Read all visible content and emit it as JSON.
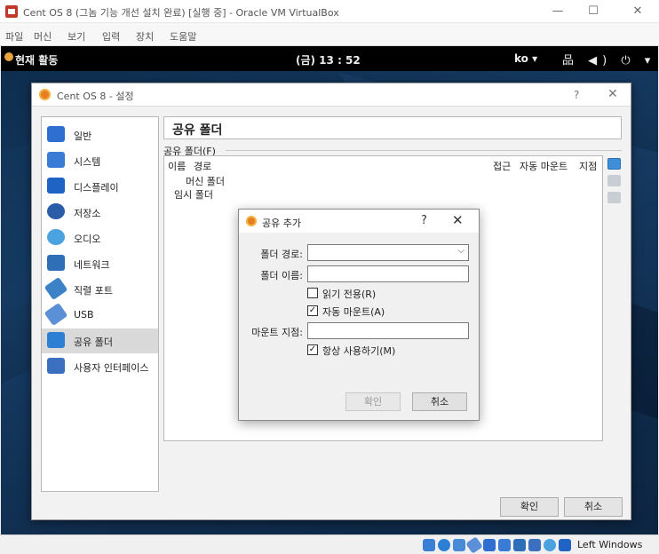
{
  "vbox": {
    "title": "Cent OS 8 (그놈 기능 개선 설치 완료) [실행 중] - Oracle VM VirtualBox",
    "menu": [
      "파일",
      "머신",
      "보기",
      "입력",
      "장치",
      "도움말"
    ],
    "controls": {
      "minimize": "—",
      "maximize": "☐",
      "close": "✕"
    }
  },
  "gnome": {
    "activities": "현재 활동",
    "clock": "(금) 13 : 52",
    "lang": "ko ▾",
    "sys": "品 ◀) ⏻ ▾"
  },
  "settings": {
    "title": "Cent OS 8 - 설정",
    "help": "?",
    "close": "✕",
    "nav": [
      {
        "label": "일반",
        "icon": "general-icon",
        "color": "#2e6fd1"
      },
      {
        "label": "시스템",
        "icon": "system-icon",
        "color": "#3a7bd5"
      },
      {
        "label": "디스플레이",
        "icon": "display-icon",
        "color": "#1f63c4"
      },
      {
        "label": "저장소",
        "icon": "storage-icon",
        "color": "#2a5ca8"
      },
      {
        "label": "오디오",
        "icon": "audio-icon",
        "color": "#4aa3df"
      },
      {
        "label": "네트워크",
        "icon": "network-icon",
        "color": "#2f6fb8"
      },
      {
        "label": "직렬 포트",
        "icon": "serial-port-icon",
        "color": "#3b82c6"
      },
      {
        "label": "USB",
        "icon": "usb-icon",
        "color": "#5b8fd6"
      },
      {
        "label": "공유 폴더",
        "icon": "shared-folder-icon",
        "color": "#2d7fd3"
      },
      {
        "label": "사용자 인터페이스",
        "icon": "user-interface-icon",
        "color": "#3b6fc0"
      }
    ],
    "selected_nav": "공유 폴더",
    "page_title": "공유 폴더",
    "group_label": "공유 폴더(F)",
    "columns": {
      "name": "이름",
      "path": "경로",
      "access": "접근",
      "auto_mount": "자동 마운트",
      "mount_point": "지점"
    },
    "rows": [
      "머신 폴더",
      "임시 폴더"
    ],
    "ok": "확인",
    "cancel": "취소"
  },
  "dialog": {
    "title": "공유 추가",
    "help": "?",
    "close": "✕",
    "folder_path_label": "폴더 경로:",
    "folder_path_value": "",
    "folder_name_label": "폴더 이름:",
    "folder_name_value": "",
    "read_only_label": "읽기 전용(R)",
    "read_only_checked": false,
    "auto_mount_label": "자동 마운트(A)",
    "auto_mount_checked": true,
    "mount_point_label": "마운트 지점:",
    "mount_point_value": "",
    "permanent_label": "항상 사용하기(M)",
    "permanent_checked": true,
    "ok": "확인",
    "cancel": "취소"
  },
  "statusbar": {
    "host_key": "Left Windows"
  }
}
